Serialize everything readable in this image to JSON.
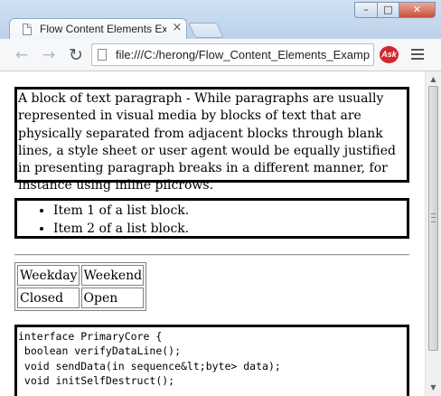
{
  "browser": {
    "tab_title": "Flow Content Elements Example",
    "tab_close": "×",
    "url": "file:///C:/herong/Flow_Content_Elements_Example.html",
    "ask_label": "Ask",
    "window_controls": {
      "minimize": "–",
      "maximize": "□",
      "close": "✕"
    },
    "nav": {
      "back": "←",
      "forward": "→",
      "reload": "↻"
    }
  },
  "page": {
    "paragraph": "A block of text paragraph - While paragraphs are usually represented in visual media by blocks of text that are physically separated from adjacent blocks through blank lines, a style sheet or user agent would be equally justified in presenting paragraph breaks in a different manner, for instance using inline pilcrows.",
    "list_items": [
      "Item 1 of a list block.",
      "Item 2 of a list block."
    ],
    "table": {
      "rows": [
        [
          "Weekday",
          "Weekend"
        ],
        [
          "Closed",
          "Open"
        ]
      ]
    },
    "code_lines": [
      "interface PrimaryCore {",
      " boolean verifyDataLine();",
      " void sendData(in sequence&lt;byte> data);",
      " void initSelfDestruct();"
    ]
  },
  "scrollbar": {
    "up": "▲",
    "down": "▼"
  }
}
